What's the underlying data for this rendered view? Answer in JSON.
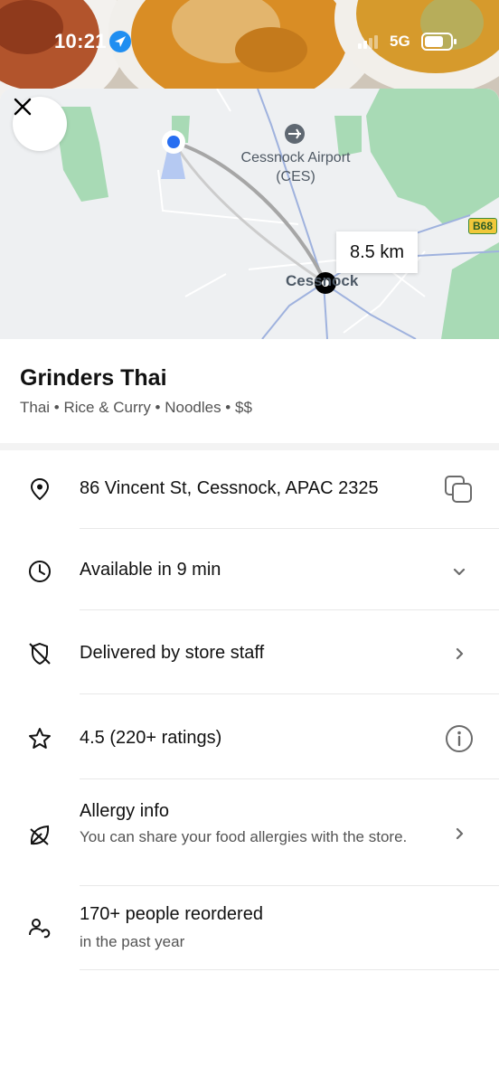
{
  "status_bar": {
    "time": "10:21",
    "network": "5G"
  },
  "map": {
    "airport_name": "Cessnock Airport",
    "airport_code": "(CES)",
    "city": "Cessnock",
    "road": "B68",
    "distance": "8.5 km"
  },
  "store": {
    "name": "Grinders Thai",
    "tags": "Thai • Rice & Curry • Noodles • $$"
  },
  "info": {
    "address": "86 Vincent St, Cessnock, APAC 2325",
    "availability": "Available in 9 min",
    "delivery": "Delivered by store staff",
    "rating": "4.5 (220+ ratings)",
    "allergy_title": "Allergy info",
    "allergy_sub": "You can share your food allergies with the store.",
    "reorder_title": "170+ people reordered",
    "reorder_sub": "in the past year"
  },
  "icons": {
    "close": "close-icon",
    "location": "location-pin-icon",
    "clock": "clock-icon",
    "delivery": "no-courier-icon",
    "star": "star-icon",
    "allergy": "leaf-icon",
    "reorder": "person-repeat-icon",
    "copy": "copy-icon",
    "chevron_down": "chevron-down-icon",
    "chevron_right": "chevron-right-icon",
    "info": "info-icon"
  },
  "colors": {
    "accent_blue": "#276ef1",
    "map_green": "#a8dab5",
    "road_badge": "#f0c83a"
  }
}
